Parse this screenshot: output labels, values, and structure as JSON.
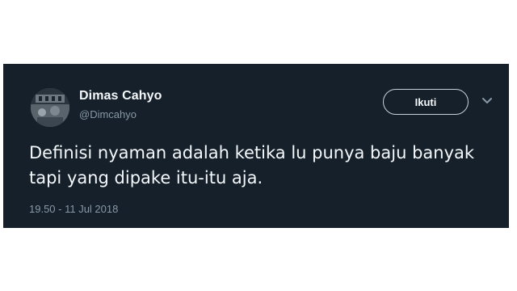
{
  "tweet": {
    "display_name": "Dimas Cahyo",
    "handle": "@Dimcahyo",
    "follow_label": "Ikuti",
    "text": "Definisi nyaman adalah ketika lu punya baju banyak tapi yang dipake itu-itu aja.",
    "timestamp": "19.50 - 11 Jul 2018",
    "avatar_icon": "profile-photo",
    "menu_icon": "chevron-down-icon"
  },
  "colors": {
    "card_background": "#15202b",
    "primary_text": "#f5f8fa",
    "secondary_text": "#8899a6",
    "button_border": "#c7d0d8"
  }
}
